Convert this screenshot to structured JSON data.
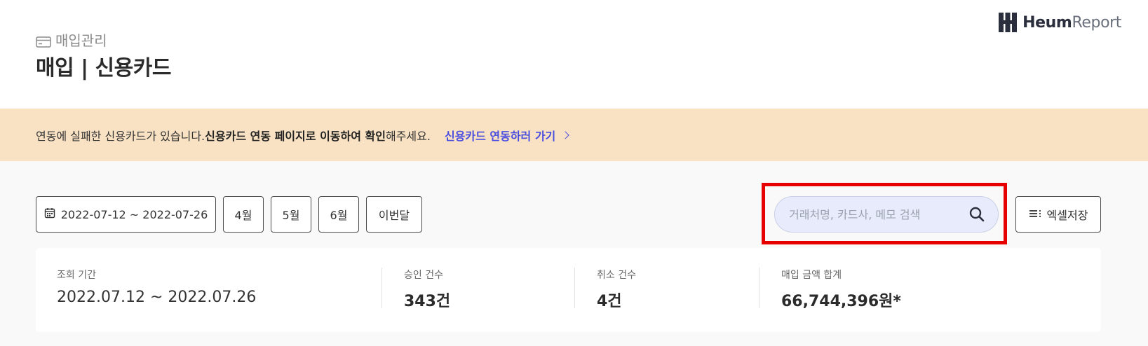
{
  "header": {
    "section_label": "매입관리",
    "page_title": "매입 | 신용카드",
    "brand_bold": "Heum",
    "brand_light": "Report"
  },
  "banner": {
    "text_prefix": "연동에 실패한 신용카드가 있습니다. ",
    "text_bold": "신용카드 연동 페이지로 이동하여 확인",
    "text_suffix": "해주세요.",
    "link_label": "신용카드 연동하러 가기"
  },
  "filters": {
    "date_range": "2022-07-12 ~ 2022-07-26",
    "month_4": "4월",
    "month_5": "5월",
    "month_6": "6월",
    "this_month": "이번달"
  },
  "search": {
    "placeholder": "거래처명, 카드사, 메모 검색",
    "value": ""
  },
  "excel": {
    "label": "엑셀저장"
  },
  "summary": {
    "period_label": "조회 기간",
    "period_value": "2022.07.12 ~ 2022.07.26",
    "approved_label": "승인 건수",
    "approved_value": "343건",
    "cancelled_label": "취소 건수",
    "cancelled_value": "4건",
    "total_label": "매입 금액 합계",
    "total_value": "66,744,396원*"
  },
  "colors": {
    "banner_bg": "#f8e2c3",
    "link": "#4a4ee0",
    "search_bg": "#e8ebfb",
    "highlight": "#e60000"
  }
}
